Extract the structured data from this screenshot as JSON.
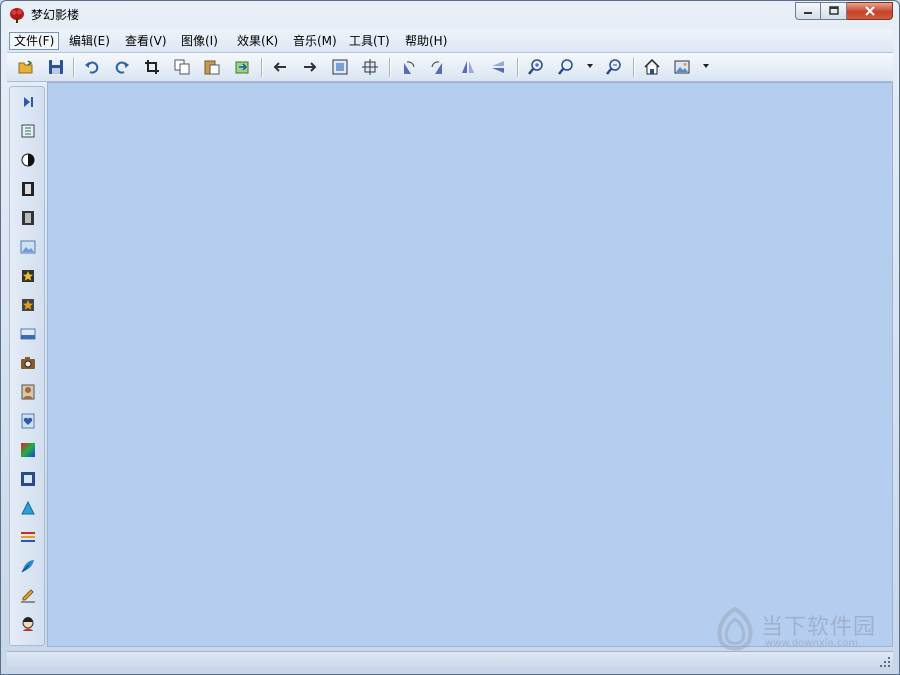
{
  "window": {
    "title": "梦幻影楼"
  },
  "menu": [
    {
      "id": "file",
      "label": "文件(F)"
    },
    {
      "id": "edit",
      "label": "编辑(E)"
    },
    {
      "id": "view",
      "label": "查看(V)"
    },
    {
      "id": "image",
      "label": "图像(I)"
    },
    {
      "id": "effects",
      "label": "效果(K)"
    },
    {
      "id": "music",
      "label": "音乐(M)"
    },
    {
      "id": "tools",
      "label": "工具(T)"
    },
    {
      "id": "help",
      "label": "帮助(H)"
    }
  ],
  "toolbar_icons": [
    "open-icon",
    "save-icon",
    "undo-icon",
    "redo-icon",
    "crop-icon",
    "copy-icon",
    "paste-icon",
    "export-icon",
    "prev-icon",
    "next-icon",
    "fit-window-icon",
    "actual-size-icon",
    "rotate-left-icon",
    "rotate-right-icon",
    "flip-horizontal-icon",
    "flip-vertical-icon",
    "zoom-in-icon",
    "zoom-icon",
    "zoom-out-icon",
    "home-icon",
    "picture-icon"
  ],
  "sidebar_icons": [
    "play-icon",
    "list-icon",
    "contrast-icon",
    "frame-1-icon",
    "frame-2-icon",
    "landscape-icon",
    "star-frame-icon",
    "star-frame-2-icon",
    "bar-icon",
    "camera-icon",
    "portrait-icon",
    "heart-frame-icon",
    "color-gradient-icon",
    "film-frame-icon",
    "triangle-icon",
    "lines-icon",
    "feather-icon",
    "pencil-icon",
    "avatar-icon"
  ],
  "watermark": {
    "title": "当下软件园",
    "url": "www.downxia.com"
  },
  "colors": {
    "canvas": "#b5cdee",
    "accent": "#3366aa",
    "close": "#c7432a"
  }
}
